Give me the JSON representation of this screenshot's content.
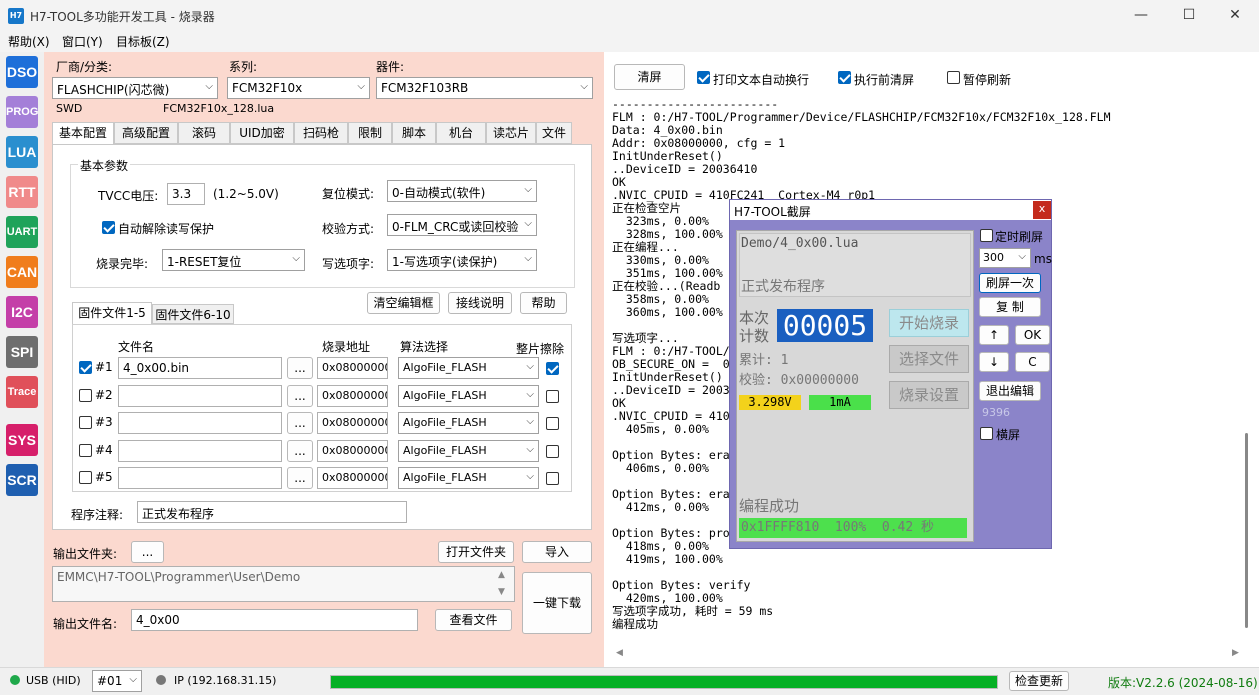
{
  "window": {
    "title": "H7-TOOL多功能开发工具 - 烧录器",
    "icon_text": "H7",
    "min": "—",
    "max": "☐",
    "close": "✕"
  },
  "menu": [
    "帮助(X)",
    "窗口(Y)",
    "目标板(Z)"
  ],
  "sidebar": [
    {
      "label": "DSO",
      "color": "#1e6fd9"
    },
    {
      "label": "PROG",
      "color": "#a47fd8"
    },
    {
      "label": "LUA",
      "color": "#2a8fcf"
    },
    {
      "label": "RTT",
      "color": "#f08a8a"
    },
    {
      "label": "UART",
      "color": "#1fa35a"
    },
    {
      "label": "CAN",
      "color": "#f07d1c"
    },
    {
      "label": "I2C",
      "color": "#c43fa8"
    },
    {
      "label": "SPI",
      "color": "#6e6e6e"
    },
    {
      "label": "Trace",
      "color": "#e0505a"
    },
    {
      "label": "SYS",
      "color": "#d61f6a"
    },
    {
      "label": "SCR",
      "color": "#1f5fb0"
    }
  ],
  "device": {
    "vendor_label": "厂商/分类:",
    "vendor": "FLASHCHIP(闪芯微)",
    "series_label": "系列:",
    "series": "FCM32F10x",
    "device_label": "器件:",
    "device": "FCM32F103RB",
    "interface": "SWD",
    "lua_file": "FCM32F10x_128.lua"
  },
  "tabs": [
    "基本配置",
    "高级配置",
    "滚码",
    "UID加密",
    "扫码枪",
    "限制",
    "脚本",
    "机台",
    "读芯片",
    "文件"
  ],
  "basic": {
    "group_label": "基本参数",
    "tvcc_label": "TVCC电压:",
    "tvcc_value": "3.3",
    "tvcc_range": "(1.2~5.0V)",
    "reset_label": "复位模式:",
    "reset_value": "0-自动模式(软件)",
    "auto_unprotect_label": "自动解除读写保护",
    "verify_label": "校验方式:",
    "verify_value": "0-FLM_CRC或读回校验",
    "after_label": "烧录完毕:",
    "after_value": "1-RESET复位",
    "option_label": "写选项字:",
    "option_value": "1-写选项字(读保护)"
  },
  "files": {
    "tab1": "固件文件1-5",
    "tab2": "固件文件6-10",
    "btn_clear": "清空编辑框",
    "btn_wiring": "接线说明",
    "btn_help": "帮助",
    "col_file": "文件名",
    "col_addr": "烧录地址",
    "col_algo": "算法选择",
    "col_erase": "整片擦除",
    "rows": [
      {
        "no": "#1",
        "checked": true,
        "file": "4_0x00.bin",
        "addr": "0x08000000",
        "algo": "AlgoFile_FLASH",
        "erase": true
      },
      {
        "no": "#2",
        "checked": false,
        "file": "",
        "addr": "0x08000000",
        "algo": "AlgoFile_FLASH",
        "erase": false
      },
      {
        "no": "#3",
        "checked": false,
        "file": "",
        "addr": "0x08000000",
        "algo": "AlgoFile_FLASH",
        "erase": false
      },
      {
        "no": "#4",
        "checked": false,
        "file": "",
        "addr": "0x08000000",
        "algo": "AlgoFile_FLASH",
        "erase": false
      },
      {
        "no": "#5",
        "checked": false,
        "file": "",
        "addr": "0x08000000",
        "algo": "AlgoFile_FLASH",
        "erase": false
      }
    ],
    "browse": "...",
    "note_label": "程序注释:",
    "note_value": "正式发布程序"
  },
  "output": {
    "folder_label": "输出文件夹:",
    "browse": "...",
    "open_folder": "打开文件夹",
    "import": "导入",
    "path": "EMMC\\H7-TOOL\\Programmer\\User\\Demo",
    "filename_label": "输出文件名:",
    "filename": "4_0x00",
    "view_file": "查看文件",
    "one_click": "一键下载"
  },
  "log_toolbar": {
    "clear": "清屏",
    "wrap": "打印文本自动换行",
    "clear_before": "执行前清屏",
    "pause": "暂停刷新"
  },
  "log_lines": [
    "------------------------",
    "FLM : 0:/H7-TOOL/Programmer/Device/FLASHCHIP/FCM32F10x/FCM32F10x_128.FLM",
    "Data: 4_0x00.bin",
    "Addr: 0x08000000, cfg = 1",
    "InitUnderReset()",
    "..DeviceID = 20036410",
    "OK",
    ".NVIC_CPUID = 410FC241  Cortex-M4 r0p1",
    "正在检查空片",
    "  323ms, 0.00%",
    "  328ms, 100.00%",
    "正在编程...",
    "  330ms, 0.00%",
    "  351ms, 100.00%",
    "正在校验...(Readb",
    "  358ms, 0.00%",
    "  360ms, 100.00%",
    "",
    "写选项字...",
    "FLM : 0:/H7-TOOL/                                   x_OPT.FLM",
    "OB_SECURE_ON =  0",
    "InitUnderReset()",
    "..DeviceID = 2003",
    "OK",
    ".NVIC_CPUID = 410",
    "  405ms, 0.00%",
    "",
    "Option Bytes: era",
    "  406ms, 0.00%",
    "",
    "Option Bytes: era",
    "  412ms, 0.00%",
    "",
    "Option Bytes: pro",
    "  418ms, 0.00%",
    "  419ms, 100.00%",
    "",
    "Option Bytes: verify",
    "  420ms, 100.00%",
    "写选项字成功, 耗时 = 59 ms",
    "编程成功"
  ],
  "screen_dialog": {
    "title": "H7-TOOL截屏",
    "close": "x",
    "lua": "Demo/4_0x00.lua",
    "desc": "正式发布程序",
    "count_label1": "本次",
    "count_label2": "计数",
    "count": "00005",
    "btn_start": "开始烧录",
    "btn_select": "选择文件",
    "btn_settings": "烧录设置",
    "total": "累计: 1",
    "checksum": "校验: 0x00000000",
    "voltage": "3.298V",
    "current": "1mA",
    "result": "编程成功",
    "progress": "0x1FFFF810  100%  0.42 秒",
    "timer_refresh": "定时刷屏",
    "interval": "300",
    "ms": "ms",
    "refresh_once": "刷屏一次",
    "copy": "复 制",
    "up": "↑",
    "ok": "OK",
    "down": "↓",
    "c": "C",
    "exit_edit": "退出编辑",
    "code": "9396",
    "landscape": "横屏"
  },
  "status": {
    "usb": "USB (HID)",
    "port": "#01",
    "ip": "IP (192.168.31.15)",
    "check_update": "检查更新",
    "version": "版本:V2.2.6 (2024-08-16)",
    "progress": 1.0
  }
}
